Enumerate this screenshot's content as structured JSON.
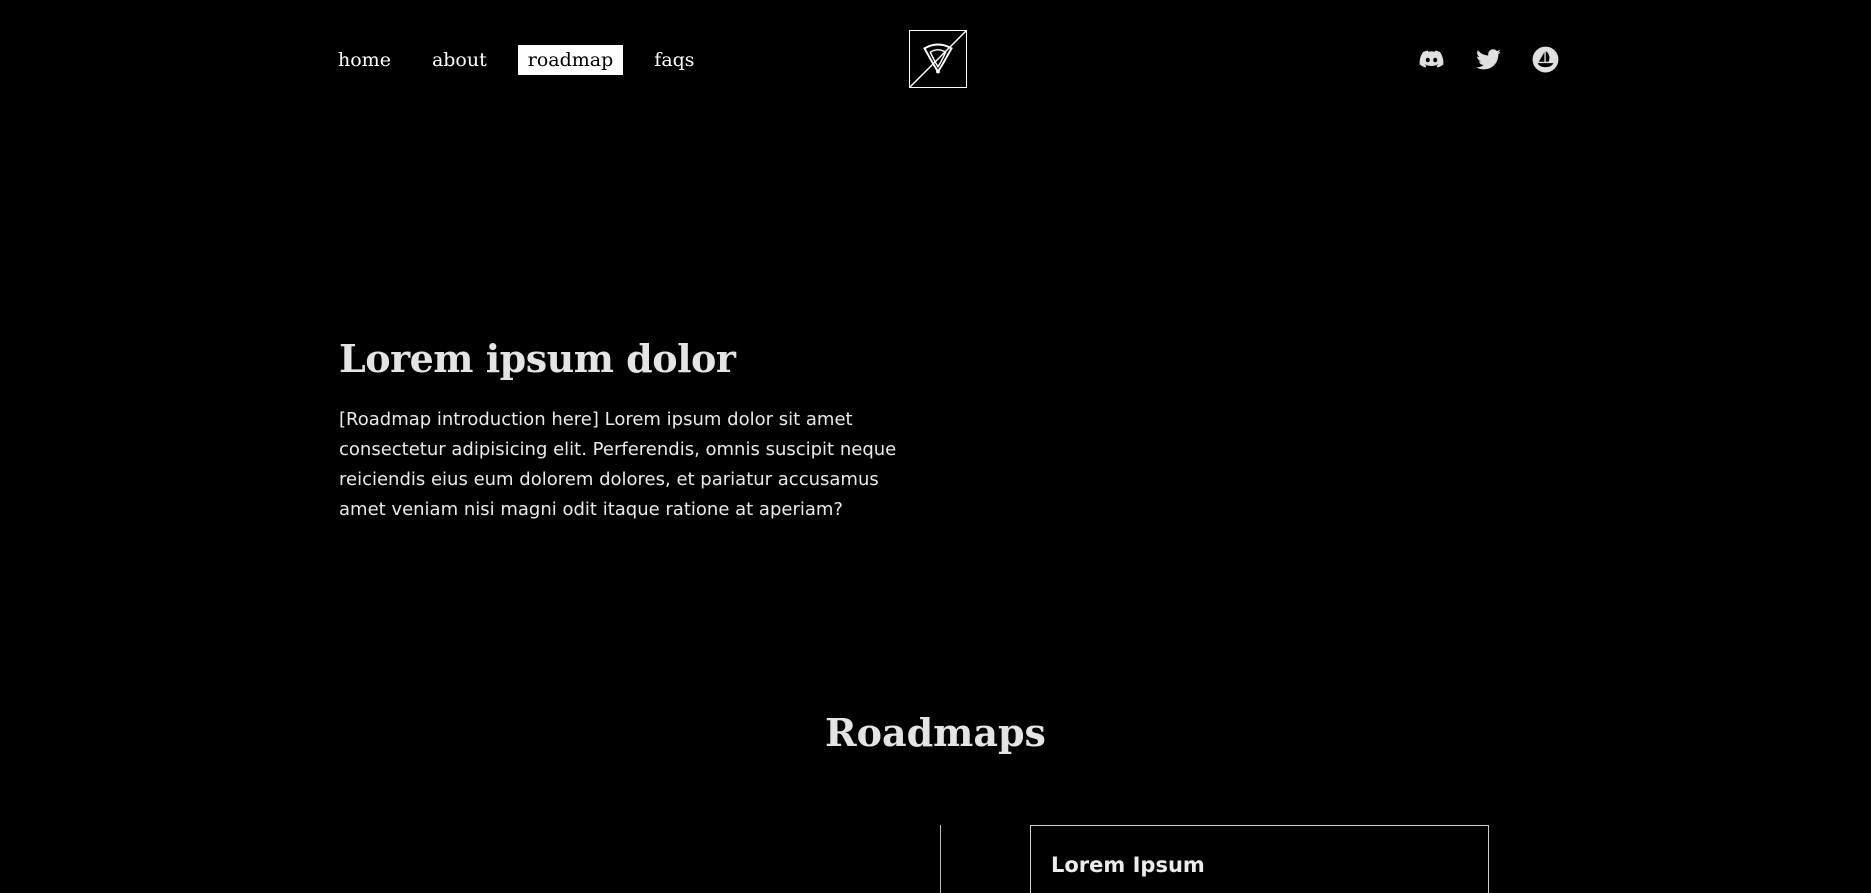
{
  "nav": {
    "items": [
      {
        "label": "home",
        "active": false
      },
      {
        "label": "about",
        "active": false
      },
      {
        "label": "roadmap",
        "active": true
      },
      {
        "label": "faqs",
        "active": false
      }
    ]
  },
  "logo": {
    "icon": "shield-logo-icon"
  },
  "socials": [
    {
      "icon": "discord-icon"
    },
    {
      "icon": "twitter-icon"
    },
    {
      "icon": "opensea-icon"
    }
  ],
  "hero": {
    "title": "Lorem ipsum dolor",
    "body": "[Roadmap introduction here] Lorem ipsum dolor sit amet consectetur adipisicing elit. Perferendis, omnis suscipit neque reiciendis eius eum dolorem dolores, et pariatur accusamus amet veniam nisi magni odit itaque ratione at aperiam?"
  },
  "roadmaps": {
    "title": "Roadmaps",
    "cards": [
      {
        "title": "Lorem Ipsum"
      }
    ]
  },
  "colors": {
    "background": "#000000",
    "text": "#e6e6e6",
    "active_nav_bg": "#ffffff",
    "active_nav_text": "#000000"
  }
}
